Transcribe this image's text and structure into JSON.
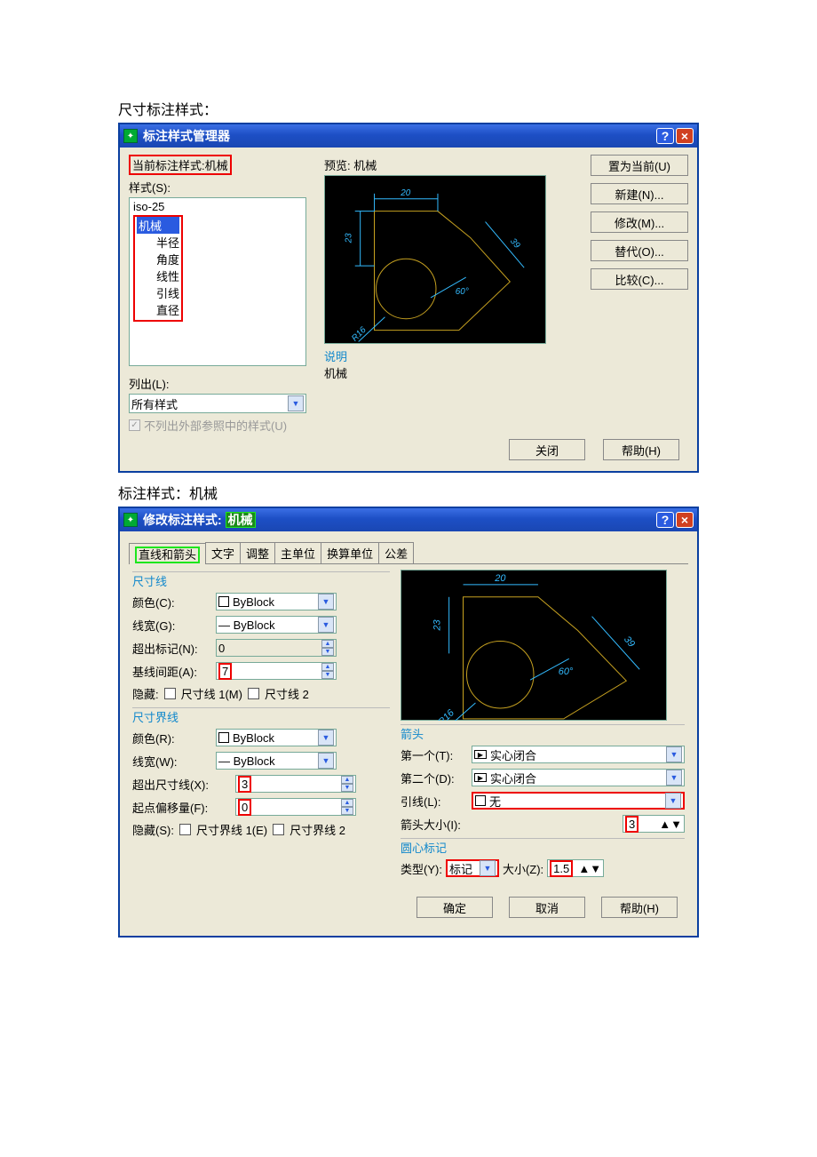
{
  "doc": {
    "heading1": "尺寸标注样式：",
    "heading2": "标注样式：机械"
  },
  "mgr": {
    "title": "标注样式管理器",
    "current_style_label": "当前标注样式:机械",
    "styles_label": "样式(S):",
    "styles": {
      "iso": "iso-25",
      "sel": "机械",
      "c1": "半径",
      "c2": "角度",
      "c3": "线性",
      "c4": "引线",
      "c5": "直径"
    },
    "list_label": "列出(L):",
    "list_value": "所有样式",
    "chk_label": "不列出外部参照中的样式(U)",
    "preview_label": "预览:  机械",
    "desc_title": "说明",
    "desc_value": "机械",
    "btns": {
      "set": "置为当前(U)",
      "new": "新建(N)...",
      "mod": "修改(M)...",
      "ovr": "替代(O)...",
      "cmp": "比较(C)..."
    },
    "close": "关闭",
    "help": "帮助(H)"
  },
  "edit": {
    "title_prefix": "修改标注样式: ",
    "title_style": "机械",
    "tabs": {
      "t1": "直线和箭头",
      "t2": "文字",
      "t3": "调整",
      "t4": "主单位",
      "t5": "换算单位",
      "t6": "公差"
    },
    "dim_line": {
      "group": "尺寸线",
      "color_lbl": "颜色(C):",
      "color_val": "ByBlock",
      "lw_lbl": "线宽(G):",
      "lw_val": "— ByBlock",
      "ext_lbl": "超出标记(N):",
      "ext_val": "0",
      "base_lbl": "基线间距(A):",
      "base_val": "7",
      "hide_lbl": "隐藏:",
      "hide1": "尺寸线 1(M)",
      "hide2": "尺寸线 2"
    },
    "ext_line": {
      "group": "尺寸界线",
      "color_lbl": "颜色(R):",
      "color_val": "ByBlock",
      "lw_lbl": "线宽(W):",
      "lw_val": "— ByBlock",
      "beyond_lbl": "超出尺寸线(X):",
      "beyond_val": "3",
      "origin_lbl": "起点偏移量(F):",
      "origin_val": "0",
      "hide_lbl": "隐藏(S):",
      "hide1": "尺寸界线 1(E)",
      "hide2": "尺寸界线 2"
    },
    "arrow": {
      "group": "箭头",
      "first_lbl": "第一个(T):",
      "first_val": "实心闭合",
      "second_lbl": "第二个(D):",
      "second_val": "实心闭合",
      "leader_lbl": "引线(L):",
      "leader_val": "无",
      "size_lbl": "箭头大小(I):",
      "size_val": "3"
    },
    "center": {
      "group": "圆心标记",
      "type_lbl": "类型(Y):",
      "type_val": "标记",
      "sz_lbl": "大小(Z):",
      "sz_val": "1.5"
    },
    "ok": "确定",
    "cancel": "取消",
    "help": "帮助(H)"
  }
}
